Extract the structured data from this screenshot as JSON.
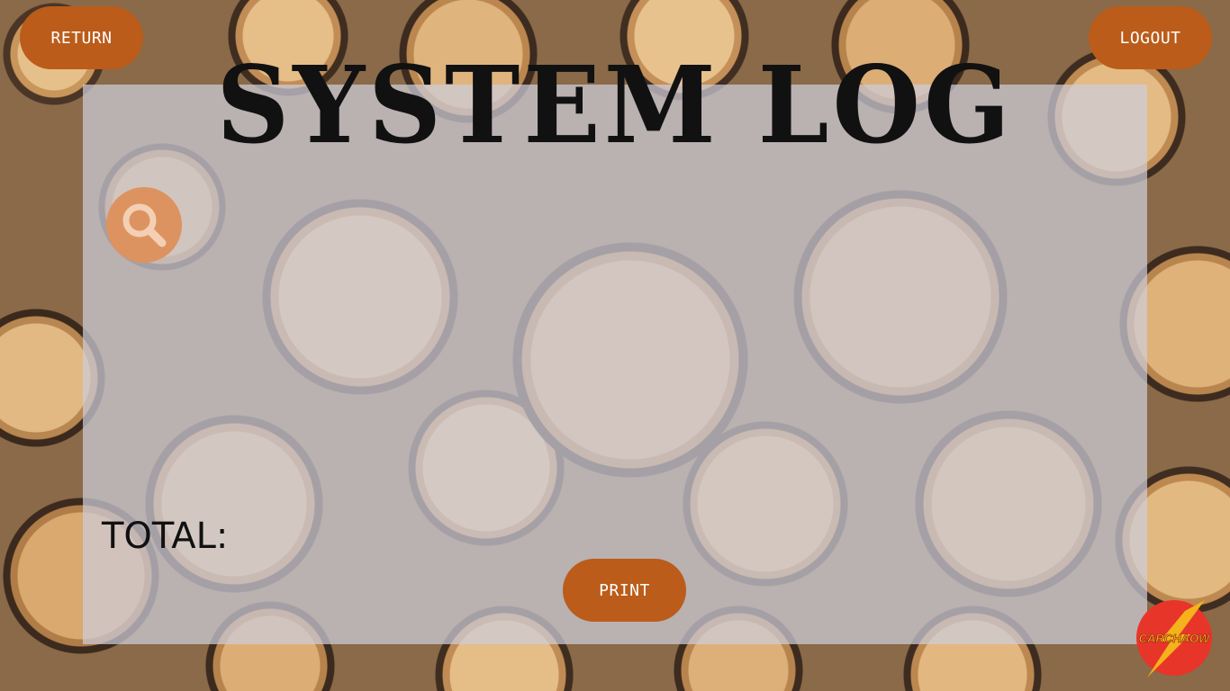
{
  "header": {
    "return_label": "RETURN",
    "logout_label": "LOGOUT"
  },
  "main": {
    "title": "SYSTEM LOG",
    "search_icon": "search-icon",
    "total_label": "TOTAL:",
    "print_label": "PRINT"
  },
  "brand": {
    "logo_text": "CARCHAOW",
    "logo_icon": "lightning-bolt-icon"
  },
  "colors": {
    "button": "#bb5c1a",
    "search_button": "#dd9360",
    "panel": "#cdcdda",
    "logo_red": "#e8352a",
    "logo_yellow": "#f5b21b"
  }
}
